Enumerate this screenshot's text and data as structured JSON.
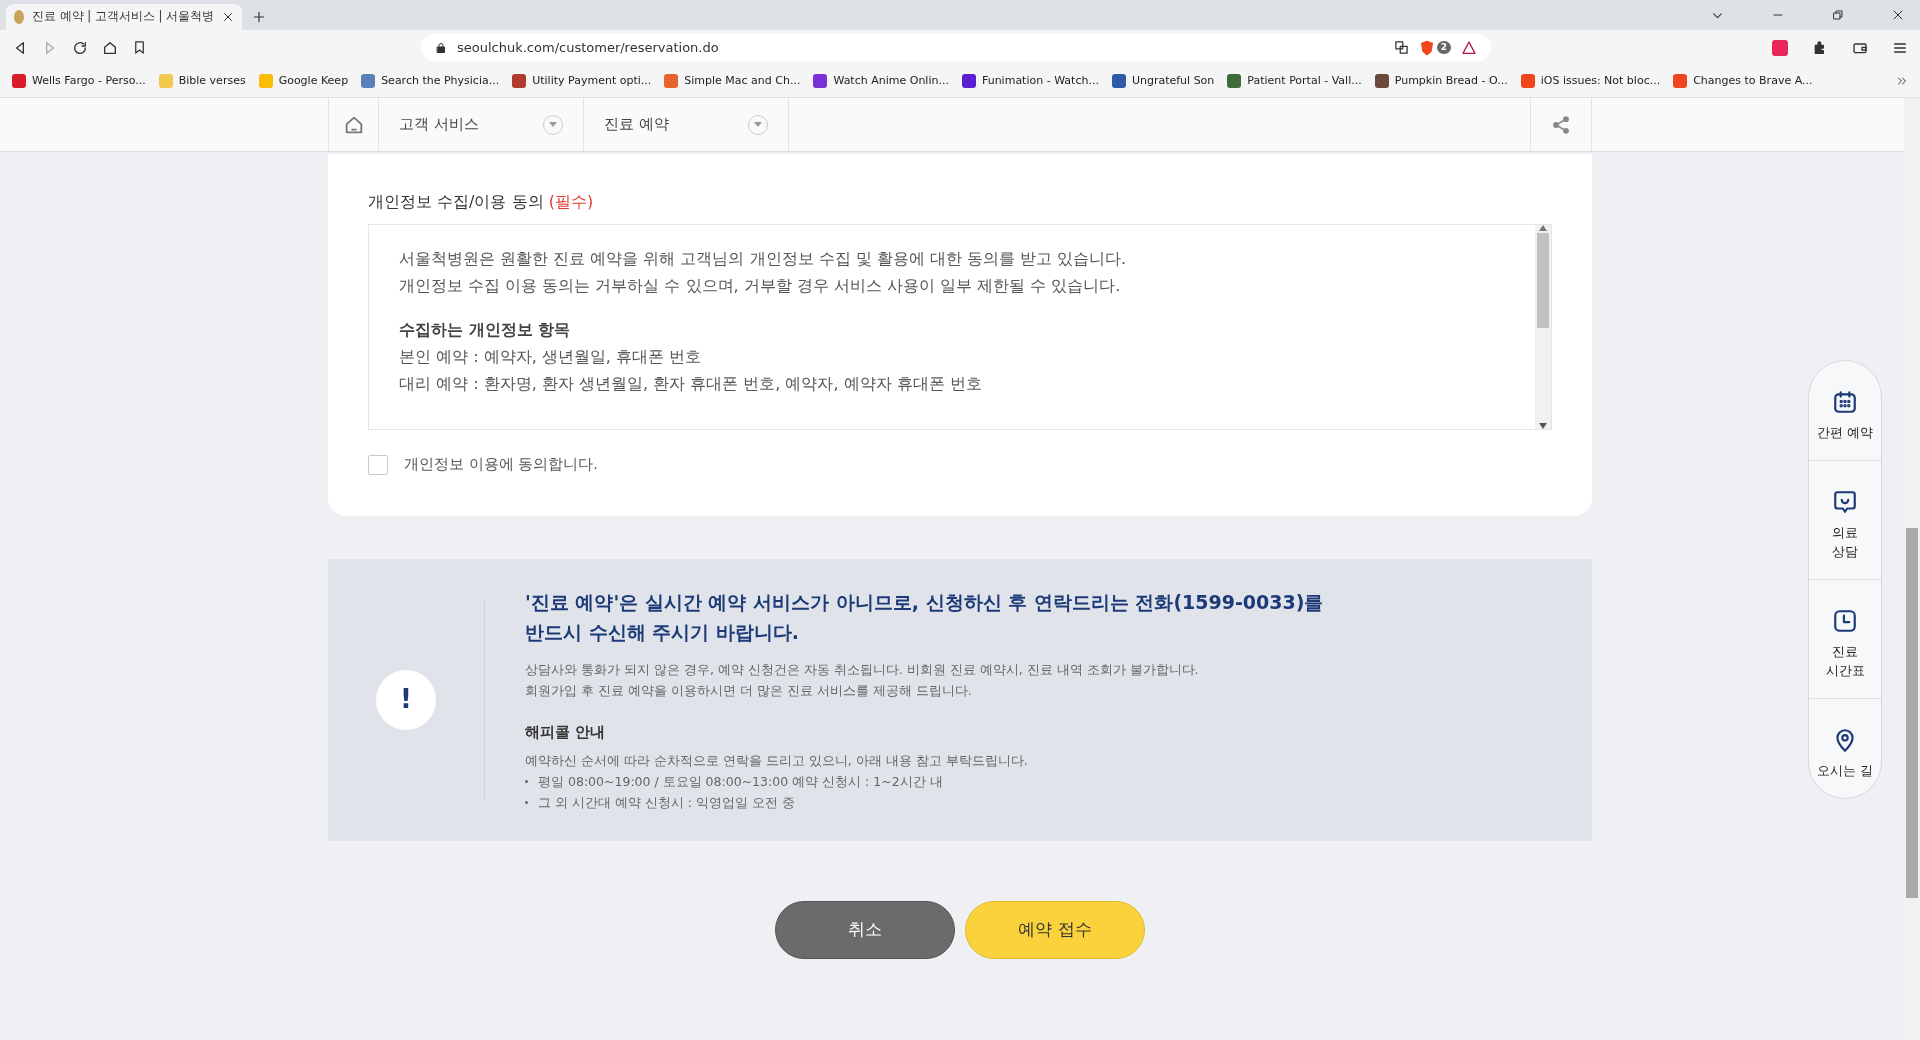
{
  "browser": {
    "tab_title": "진료 예약 | 고객서비스 | 서울척병",
    "url": "seoulchuk.com/customer/reservation.do",
    "extension_badge": "2",
    "bookmarks": [
      {
        "label": "Wells Fargo - Perso...",
        "color": "#d71e28"
      },
      {
        "label": "Bible verses",
        "color": "#f2c94c"
      },
      {
        "label": "Google Keep",
        "color": "#fbbc04"
      },
      {
        "label": "Search the Physicia...",
        "color": "#5b7fb8"
      },
      {
        "label": "Utility Payment opti...",
        "color": "#b03a2e"
      },
      {
        "label": "Simple Mac and Ch...",
        "color": "#e8622c"
      },
      {
        "label": "Watch Anime Onlin...",
        "color": "#7b2fd6"
      },
      {
        "label": "Funimation - Watch...",
        "color": "#5b1fd1"
      },
      {
        "label": "Ungrateful Son",
        "color": "#2d5aa8"
      },
      {
        "label": "Patient Portal - Vall...",
        "color": "#3d6b3a"
      },
      {
        "label": "Pumpkin Bread - O...",
        "color": "#6b4a3a"
      },
      {
        "label": "iOS issues: Not bloc...",
        "color": "#f1461d"
      },
      {
        "label": "Changes to Brave A...",
        "color": "#f1461d"
      }
    ]
  },
  "nav": {
    "menus": [
      {
        "label": "고객 서비스"
      },
      {
        "label": "진료 예약"
      }
    ]
  },
  "consent": {
    "title": "개인정보 수집/이용 동의",
    "required": "(필수)",
    "paragraphs": [
      {
        "kind": "text",
        "lines": [
          "서울척병원은 원활한 진료 예약을 위해 고객님의 개인정보 수집 및 활용에 대한 동의를 받고 있습니다.",
          "개인정보 수집 이용 동의는 거부하실 수 있으며, 거부할 경우 서비스 사용이 일부 제한될 수 있습니다."
        ]
      },
      {
        "kind": "section",
        "heading": "수집하는 개인정보 항목",
        "lines": [
          "본인 예약 : 예약자, 생년월일, 휴대폰 번호",
          "대리 예약 : 환자명, 환자 생년월일, 환자 휴대폰 번호, 예약자, 예약자 휴대폰 번호"
        ]
      }
    ],
    "checkbox": {
      "label": "개인정보 이용에 동의합니다.",
      "checked": false
    }
  },
  "notice": {
    "icon_text": "!",
    "headline": [
      "'진료 예약'은 실시간 예약 서비스가 아니므로, 신청하신 후 연락드리는 전화(1599-0033)를",
      "반드시 수신해 주시기 바랍니다."
    ],
    "description": [
      "상담사와 통화가 되지 않은 경우, 예약 신청건은 자동 취소됩니다. 비회원 진료 예약시, 진료 내역 조회가 불가합니다.",
      "회원가입 후 진료 예약을 이용하시면 더 많은 진료 서비스를 제공해 드립니다."
    ],
    "subheading": "해피콜 안내",
    "intro": "예약하신 순서에 따라 순차적으로 연락을 드리고 있으니, 아래 내용 참고 부탁드립니다.",
    "bullets": [
      "평일 08:00~19:00 / 토요일 08:00~13:00 예약 신청시 : 1~2시간 내",
      "그 외 시간대 예약 신청시 : 익영업일 오전 중"
    ]
  },
  "buttons": [
    {
      "label": "취소",
      "kind": "secondary"
    },
    {
      "label": "예약 접수",
      "kind": "primary"
    }
  ],
  "quick_menu": [
    {
      "kind": "calendar",
      "lines": [
        "간편 예약"
      ]
    },
    {
      "kind": "chat",
      "lines": [
        "의료",
        "상담"
      ]
    },
    {
      "kind": "clock",
      "lines": [
        "진료",
        "시간표"
      ]
    },
    {
      "kind": "pin",
      "lines": [
        "오시는 길"
      ]
    }
  ]
}
